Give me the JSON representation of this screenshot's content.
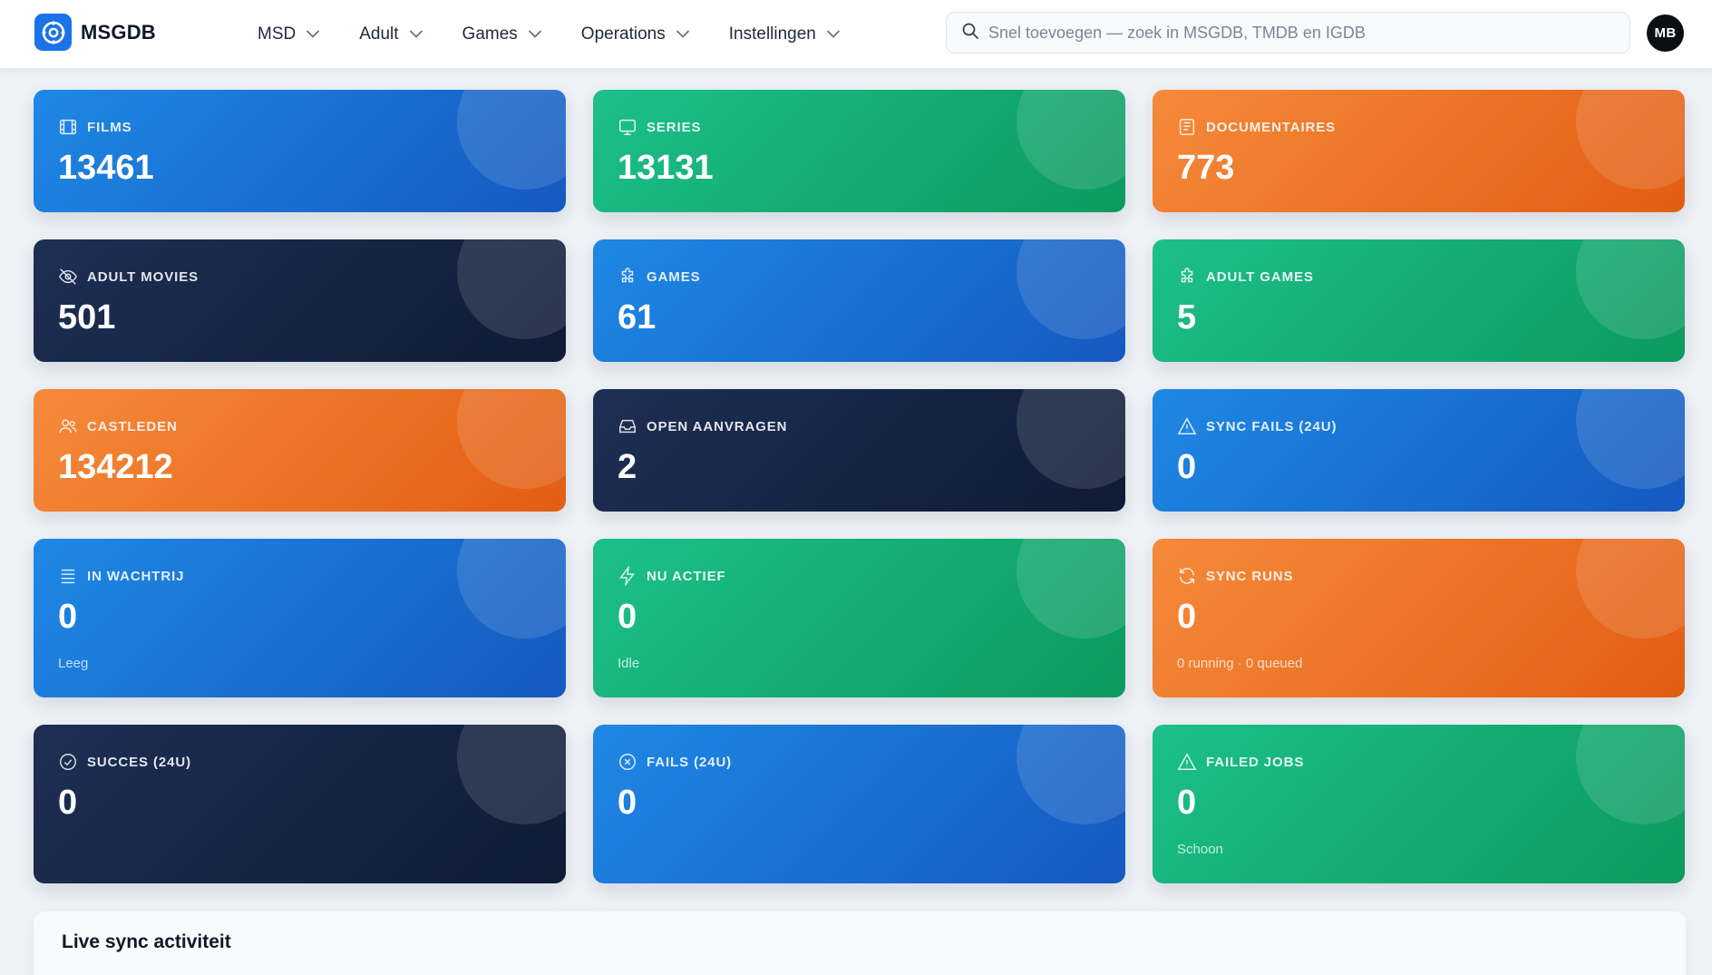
{
  "brand": {
    "name": "MSGDB",
    "icon": "target-icon",
    "color": "#1a73e8"
  },
  "nav": [
    {
      "label": "MSD"
    },
    {
      "label": "Adult"
    },
    {
      "label": "Games"
    },
    {
      "label": "Operations"
    },
    {
      "label": "Instellingen"
    }
  ],
  "search": {
    "placeholder": "Snel toevoegen — zoek in MSGDB, TMDB en IGDB",
    "value": ""
  },
  "user": {
    "initials": "MB"
  },
  "cards": [
    {
      "label": "FILMS",
      "value": "13461",
      "sub": "",
      "icon": "film-icon",
      "color": "#1e88e5"
    },
    {
      "label": "SERIES",
      "value": "13131",
      "sub": "",
      "icon": "tv-icon",
      "color": "#1cc08a"
    },
    {
      "label": "DOCUMENTAIRES",
      "value": "773",
      "sub": "",
      "icon": "newspaper-icon",
      "color": "#f68a3a"
    },
    {
      "label": "ADULT MOVIES",
      "value": "501",
      "sub": "",
      "icon": "eye-off-icon",
      "color": "#1d2f54"
    },
    {
      "label": "GAMES",
      "value": "61",
      "sub": "",
      "icon": "puzzle-icon",
      "color": "#1e88e5"
    },
    {
      "label": "ADULT GAMES",
      "value": "5",
      "sub": "",
      "icon": "puzzle-icon",
      "color": "#1cc08a"
    },
    {
      "label": "CASTLEDEN",
      "value": "134212",
      "sub": "",
      "icon": "users-icon",
      "color": "#f68a3a"
    },
    {
      "label": "OPEN AANVRAGEN",
      "value": "2",
      "sub": "",
      "icon": "inbox-icon",
      "color": "#1d2f54"
    },
    {
      "label": "SYNC FAILS (24U)",
      "value": "0",
      "sub": "",
      "icon": "warning-icon",
      "color": "#1e88e5"
    },
    {
      "label": "IN WACHTRIJ",
      "value": "0",
      "sub": "Leeg",
      "icon": "list-icon",
      "color": "#1e88e5"
    },
    {
      "label": "NU ACTIEF",
      "value": "0",
      "sub": "Idle",
      "icon": "bolt-icon",
      "color": "#1cc08a"
    },
    {
      "label": "SYNC RUNS",
      "value": "0",
      "sub": "0 running · 0 queued",
      "icon": "refresh-icon",
      "color": "#f68a3a"
    },
    {
      "label": "SUCCES (24U)",
      "value": "0",
      "sub": "",
      "icon": "check-circle-icon",
      "color": "#1d2f54"
    },
    {
      "label": "FAILS (24U)",
      "value": "0",
      "sub": "",
      "icon": "x-circle-icon",
      "color": "#1e88e5"
    },
    {
      "label": "FAILED JOBS",
      "value": "0",
      "sub": "Schoon",
      "icon": "warning-icon",
      "color": "#1cc08a"
    }
  ],
  "activity": {
    "title": "Live sync activiteit"
  }
}
